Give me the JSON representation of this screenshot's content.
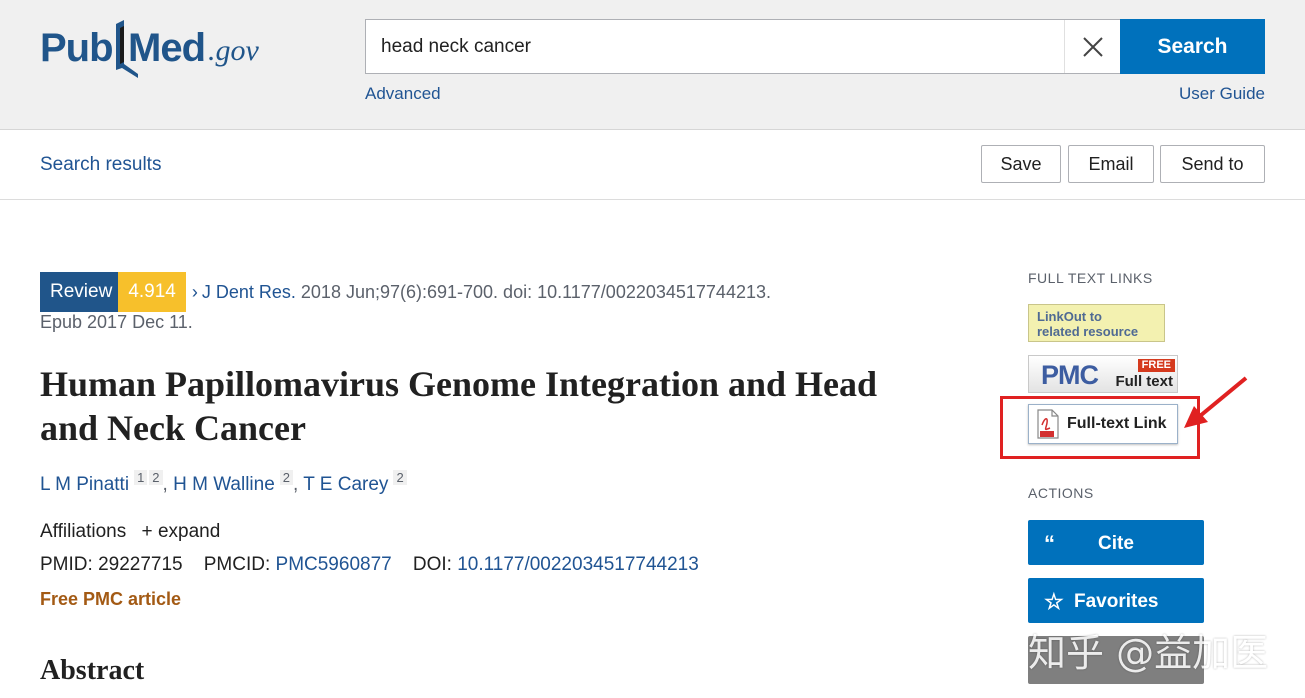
{
  "header": {
    "logo": {
      "pub": "Pub",
      "med": "Med",
      "gov": ".gov"
    },
    "search": {
      "value": "head neck cancer",
      "placeholder": "",
      "button_label": "Search"
    },
    "advanced_label": "Advanced",
    "user_guide_label": "User Guide"
  },
  "subbar": {
    "search_results_label": "Search results",
    "buttons": {
      "save": "Save",
      "email": "Email",
      "send_to": "Send to"
    }
  },
  "article": {
    "badge_type": "Review",
    "impact_factor": "4.914",
    "journal": "J Dent Res.",
    "citation": " 2018 Jun;97(6):691-700. doi: 10.1177/0022034517744213.",
    "epub": "Epub 2017 Dec 11.",
    "title": "Human Papillomavirus Genome Integration and Head and Neck Cancer",
    "authors": [
      {
        "name": "L M Pinatti",
        "affil": [
          "1",
          "2"
        ]
      },
      {
        "name": "H M Walline",
        "affil": [
          "2"
        ]
      },
      {
        "name": "T E Carey",
        "affil": [
          "2"
        ]
      }
    ],
    "affiliations_label": "Affiliations",
    "expand_label": "expand",
    "pmid_label": "PMID: ",
    "pmid": "29227715",
    "pmcid_label": "PMCID: ",
    "pmcid": "PMC5960877",
    "doi_label": "DOI: ",
    "doi": "10.1177/0022034517744213",
    "free_pmc": "Free PMC article",
    "abstract_heading": "Abstract"
  },
  "rail": {
    "full_text_links_heading": "FULL TEXT LINKS",
    "linkout": {
      "line1": "LinkOut to",
      "line2": "related resource"
    },
    "pmc": {
      "logo": "PMC",
      "free": "FREE",
      "full_text": "Full text"
    },
    "fulltext_link_label": "Full-text Link",
    "actions_heading": "ACTIONS",
    "cite_label": "Cite",
    "favorites_label": "Favorites"
  },
  "colors": {
    "brand_blue": "#20558a",
    "button_blue": "#0071bc",
    "link_blue": "#205493",
    "impact_yellow": "#f7c02b",
    "free_pmc_orange": "#a35a14",
    "highlight_red": "#e02121"
  },
  "watermark": "知乎 @益加医"
}
